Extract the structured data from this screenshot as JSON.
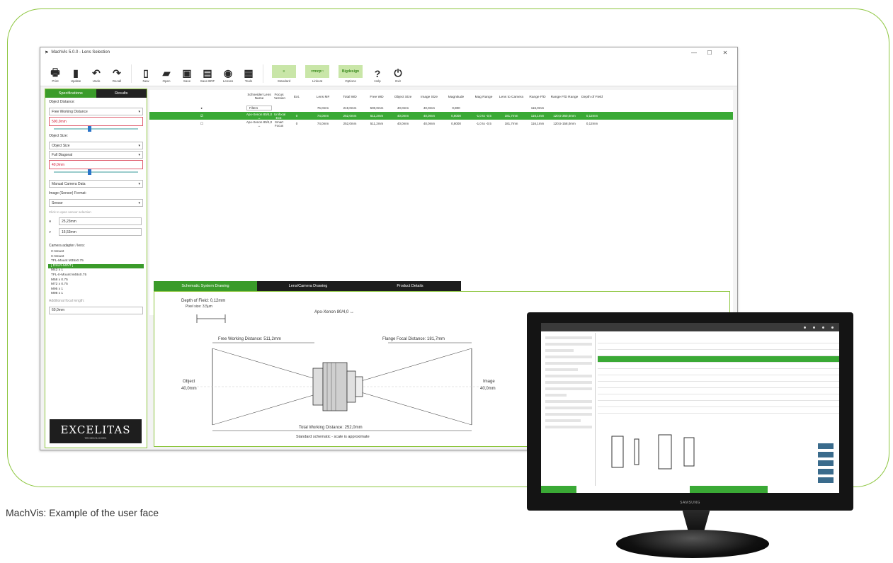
{
  "caption": "MachVis: Example of the user face",
  "window": {
    "title": "MachVis 5.0.0 - Lens Selection",
    "controls": [
      "—",
      "☐",
      "✕"
    ]
  },
  "toolbar": [
    {
      "label": "Print",
      "icon": "printer-icon",
      "glyph": "🖶"
    },
    {
      "label": "Update",
      "icon": "clipboard-icon",
      "glyph": "▮"
    },
    {
      "label": "Undo",
      "icon": "undo-icon",
      "glyph": "↶"
    },
    {
      "label": "Recall",
      "icon": "redo-icon",
      "glyph": "↷"
    },
    {
      "label": "New",
      "icon": "new-file-icon",
      "glyph": "▯"
    },
    {
      "label": "Open",
      "icon": "open-folder-icon",
      "glyph": "▰"
    },
    {
      "label": "Save",
      "icon": "save-icon",
      "glyph": "▣"
    },
    {
      "label": "Save BRF",
      "icon": "save-brf-icon",
      "glyph": "▤"
    },
    {
      "label": "Lenses",
      "icon": "lens-icon",
      "glyph": "◉"
    },
    {
      "label": "Tools",
      "icon": "tools-grid-icon",
      "glyph": "▦"
    }
  ],
  "toolbar_wide": [
    {
      "label": "Standard",
      "badge": "≡"
    },
    {
      "label": "Linkcat",
      "badge": "rrmcp□"
    },
    {
      "label": "Options",
      "badge": "Bigdesign"
    }
  ],
  "toolbar_end": [
    {
      "label": "Help",
      "icon": "help-icon",
      "glyph": "?"
    },
    {
      "label": "Exit",
      "icon": "exit-icon",
      "glyph": "⏻"
    }
  ],
  "left_panel": {
    "tabs": [
      "Specifications",
      "Results"
    ],
    "object_distance_label": "Object Distance:",
    "distance_mode": "Free Working Distance",
    "distance_value": "500,0mm",
    "object_size_label": "Object Size:",
    "object_size_mode": "Object Size",
    "object_size_mode2": "Full Diagonal",
    "object_size_value": "40,0mm",
    "camera_select": "Manual Camera Data",
    "image_sensor_label": "Image (Sensor) Format:",
    "sensor_format": "Sensor",
    "sensor_hint": "Click to open sensor selection",
    "sensor_w_label": "H",
    "sensor_w": "25,23mm",
    "sensor_h_label": "V",
    "sensor_h": "16,53mm",
    "mount_label": "Camera adapter / lens:",
    "mounts": [
      "C-Mount",
      "C-Mount",
      "TFL-Mount M35x0.75",
      "[ DSLR-MINT ]",
      "M42 x 1",
      "TFL-II-Mount M48x0.75",
      "M58 x 0.75",
      "M72 x 0.75",
      "M95 x 1",
      "M98 x 1"
    ],
    "selected_mount_index": 3,
    "focal_label": "Additional focal length:",
    "focal_value": "60,0mm",
    "logo": "EXCELITAS",
    "logo_tag": "TECHNOLOGIES"
  },
  "grid": {
    "headers": [
      "",
      "Schneider Lens Name",
      "Focus Version",
      "Ext.",
      "Lens M#",
      "Total WD",
      "Free WD",
      "Object Size",
      "Image Size",
      "Magnitude",
      "Mag Range",
      "Lens to Camera",
      "Range F/D",
      "Range F/D Range",
      "Depth of Field"
    ],
    "rows": [
      {
        "marker": "▸",
        "name": "Filters",
        "focus": "",
        "ext": "",
        "m": "76,0mm",
        "twd": "219,0mm",
        "fwd": "500,0mm",
        "obj": "40,0mm",
        "img": "40,0mm",
        "mag": "0,800",
        "range": "",
        "ltc": "",
        "rfd": "116,0mm",
        "rfdr": "",
        "dof": "",
        "cls": "first"
      },
      {
        "marker": "☑",
        "name": "Apo-Xenon 80/4,0 ↔",
        "focus": "Unifocal Extr.",
        "ext": "0",
        "m": "74,0mm",
        "twd": "252,0mm",
        "fwd": "511,2mm",
        "obj": "40,0mm",
        "img": "40,0mm",
        "mag": "0,8000",
        "range": "-1,0 to -0,5",
        "ltc": "181,7mm",
        "rfd": "116,1mm",
        "rfdr": "120,5-360,0mm",
        "dof": "0,12mm",
        "cls": "sel"
      },
      {
        "marker": "☐",
        "name": "Apo-Xenon 80/4,0 ↔",
        "focus": "Smart Focus",
        "ext": "0",
        "m": "74,0mm",
        "twd": "252,0mm",
        "fwd": "511,2mm",
        "obj": "40,0mm",
        "img": "40,0mm",
        "mag": "0,8000",
        "range": "-1,0 to -0,5",
        "ltc": "181,7mm",
        "rfd": "116,1mm",
        "rfdr": "120,5-158,0mm",
        "dof": "0,12mm",
        "cls": ""
      }
    ]
  },
  "drawing_tabs": [
    "Schematic System Drawing",
    "Lens/Camera Drawing",
    "Product Details"
  ],
  "drawing": {
    "depth_label": "Depth of Field: 0,12mm",
    "pixel_label": "Pixel size: 3,5μm",
    "lens_label": "Apo-Xenon 80/4,0 ↔",
    "fwd_label": "Free Working Distance: 511,2mm",
    "ffd_label": "Flange Focal Distance: 181,7mm",
    "object_label": "Object",
    "object_value": "40,0mm",
    "image_label": "Image",
    "image_value": "40,0mm",
    "total_label": "Total Working Distance: 252,0mm",
    "footer": "Standard schematic - scale is approximate"
  },
  "monitor": {
    "brand": "SAMSUNG"
  },
  "colors": {
    "accent": "#8dc63f",
    "selected": "#3aa935",
    "dark_tab": "#1c1c1c"
  }
}
